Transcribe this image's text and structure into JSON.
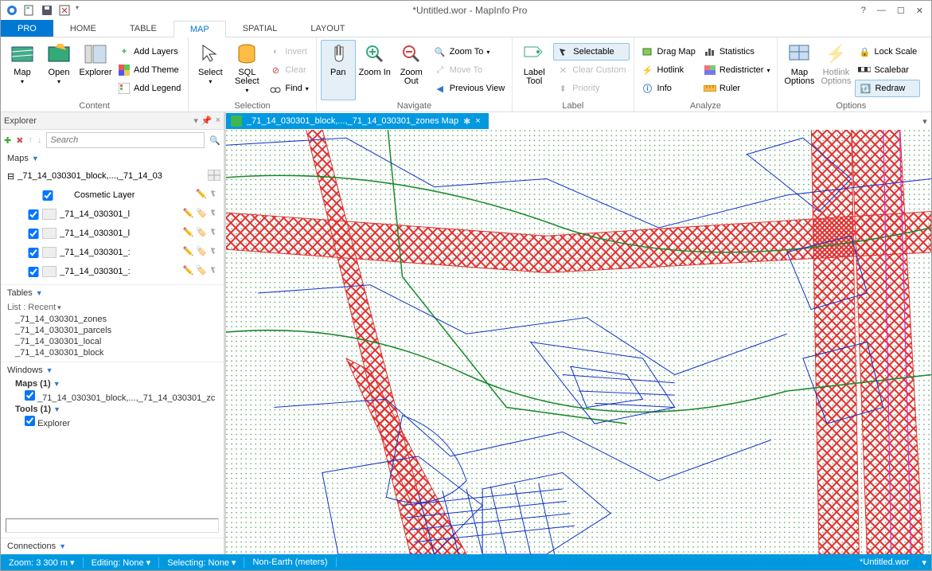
{
  "titlebar": {
    "title": "*Untitled.wor - MapInfo Pro",
    "help": "?",
    "min": "—",
    "max": "☐",
    "close": "✕"
  },
  "tabs": {
    "pro": "PRO",
    "home": "HOME",
    "table": "TABLE",
    "map": "MAP",
    "spatial": "SPATIAL",
    "layout": "LAYOUT"
  },
  "ribbon": {
    "content": {
      "label": "Content",
      "map": "Map",
      "open": "Open",
      "explorer": "Explorer",
      "addLayers": "Add Layers",
      "addTheme": "Add Theme",
      "addLegend": "Add Legend"
    },
    "selection": {
      "label": "Selection",
      "select": "Select",
      "sql": "SQL Select",
      "invert": "Invert",
      "clear": "Clear",
      "find": "Find"
    },
    "navigate": {
      "label": "Navigate",
      "pan": "Pan",
      "zoomIn": "Zoom In",
      "zoomOut": "Zoom Out",
      "zoomTo": "Zoom To",
      "moveTo": "Move To",
      "previousView": "Previous View"
    },
    "labelg": {
      "label": "Label",
      "labelTool": "Label Tool",
      "selectable": "Selectable",
      "clearCustom": "Clear Custom",
      "priority": "Priority"
    },
    "analyze": {
      "label": "Analyze",
      "dragMap": "Drag Map",
      "hotlink": "Hotlink",
      "info": "Info",
      "statistics": "Statistics",
      "redistricter": "Redistricter",
      "ruler": "Ruler"
    },
    "options": {
      "label": "Options",
      "mapOptions": "Map Options",
      "hotlinkOptions": "Hotlink Options",
      "lockScale": "Lock Scale",
      "scalebar": "Scalebar",
      "redraw": "Redraw"
    }
  },
  "explorer": {
    "title": "Explorer",
    "searchPlaceholder": "Search",
    "maps": "Maps",
    "topLayer": "_71_14_030301_block,...,_71_14_03",
    "cosmetic": "Cosmetic Layer",
    "layers": [
      "_71_14_030301_l",
      "_71_14_030301_l",
      "_71_14_030301_:",
      "_71_14_030301_:"
    ],
    "tables": "Tables",
    "listRecent": "List : Recent",
    "tableItems": [
      "_71_14_030301_zones",
      "_71_14_030301_parcels",
      "_71_14_030301_local",
      "_71_14_030301_block"
    ],
    "windows": "Windows",
    "mapsCount": "Maps (1)",
    "winItem": "_71_14_030301_block,...,_71_14_030301_zc",
    "tools": "Tools (1)",
    "toolItem": "Explorer",
    "connections": "Connections"
  },
  "maptab": {
    "title": "_71_14_030301_block,...,_71_14_030301_zones Map",
    "mark": "✱",
    "close": "×"
  },
  "status": {
    "zoom": "Zoom: 3 300 m",
    "editing": "Editing: None",
    "selecting": "Selecting: None",
    "proj": "Non-Earth (meters)",
    "file": "*Untitled.wor"
  }
}
